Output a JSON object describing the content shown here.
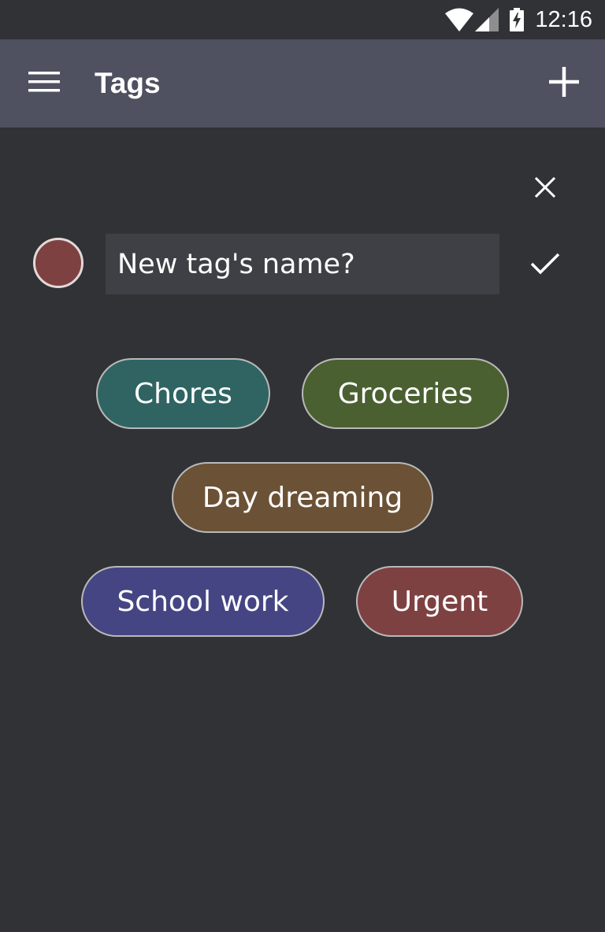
{
  "status_bar": {
    "time": "12:16",
    "icons": [
      "wifi-icon",
      "signal-icon",
      "battery-charging-icon"
    ]
  },
  "app_bar": {
    "title": "Tags",
    "menu_icon": "hamburger-menu-icon",
    "add_icon": "plus-icon"
  },
  "editor": {
    "close_icon": "close-icon",
    "confirm_icon": "check-icon",
    "selected_color": "#7e4142",
    "name_placeholder": "New tag's name?",
    "name_value": ""
  },
  "tags": [
    {
      "label": "Chores",
      "color": "#2f6463"
    },
    {
      "label": "Groceries",
      "color": "#4a6031"
    },
    {
      "label": "Day dreaming",
      "color": "#6b5135"
    },
    {
      "label": "School work",
      "color": "#454584"
    },
    {
      "label": "Urgent",
      "color": "#7e4142"
    }
  ],
  "colors": {
    "background": "#313236",
    "app_bar": "#4f5160",
    "input_background": "#3f4046",
    "chip_border": "#b9b9b9"
  }
}
